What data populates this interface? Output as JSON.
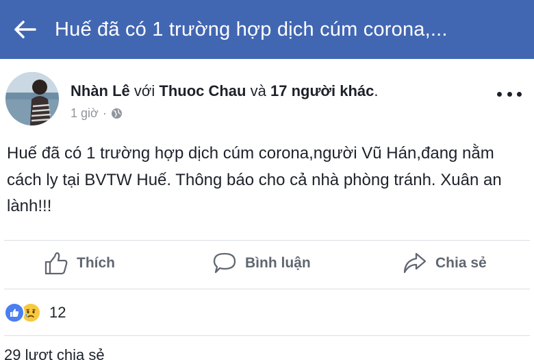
{
  "topbar": {
    "title": "Huế đã có 1 trường hợp dịch cúm corona,...",
    "back_icon": "arrow-left-icon",
    "background": "#4267b2"
  },
  "post": {
    "author": "Nhàn Lê",
    "with_word": "với",
    "tagged": "Thuoc Chau",
    "and_word": "và",
    "others": "17 người khác",
    "period": ".",
    "time": "1 giờ",
    "privacy_icon": "globe-icon",
    "text": "Huế đã có 1 trường hợp dịch cúm corona,người Vũ Hán,đang nằm cách ly tại BVTW Huế. Thông báo cho cả nhà phòng tránh. Xuân an lành!!!"
  },
  "actions": {
    "like": "Thích",
    "comment": "Bình luận",
    "share": "Chia sẻ"
  },
  "reactions": {
    "count": "12",
    "types": [
      "like",
      "sad"
    ]
  },
  "shares": {
    "text": "29 lượt chia sẻ"
  }
}
